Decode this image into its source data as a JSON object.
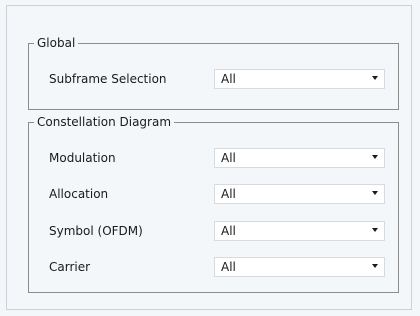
{
  "global": {
    "title": "Global",
    "subframe_selection": {
      "label": "Subframe Selection",
      "value": "All"
    }
  },
  "constellation": {
    "title": "Constellation Diagram",
    "fields": [
      {
        "label": "Modulation",
        "value": "All"
      },
      {
        "label": "Allocation",
        "value": "All"
      },
      {
        "label": "Symbol (OFDM)",
        "value": "All"
      },
      {
        "label": "Carrier",
        "value": "All"
      }
    ]
  }
}
